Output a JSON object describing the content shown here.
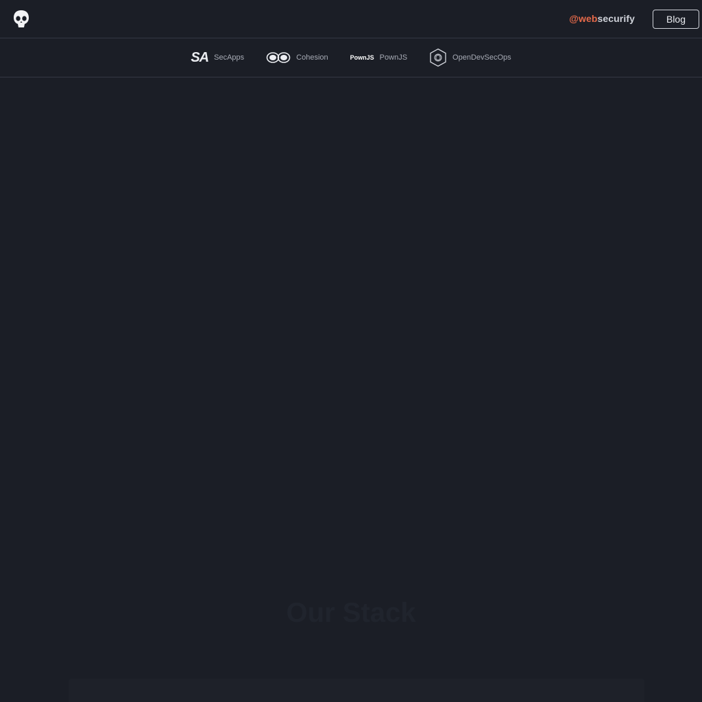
{
  "header": {
    "logo_icon": "skull-icon",
    "handle_prefix": "@web",
    "handle_suffix": "securify",
    "blog_label": "Blog",
    "accent_color": "#e66a4a"
  },
  "subnav": {
    "items": [
      {
        "label": "SecApps",
        "icon": "secapps-logo-icon",
        "mark": "SA"
      },
      {
        "label": "Cohesion",
        "icon": "cohesion-logo-icon"
      },
      {
        "label": "PownJS",
        "icon": "pownjs-logo-icon",
        "mark": "PownJS"
      },
      {
        "label": "OpenDevSecOps",
        "icon": "opendevsecops-logo-icon"
      }
    ]
  },
  "main": {
    "section_title": "Our Stack"
  }
}
